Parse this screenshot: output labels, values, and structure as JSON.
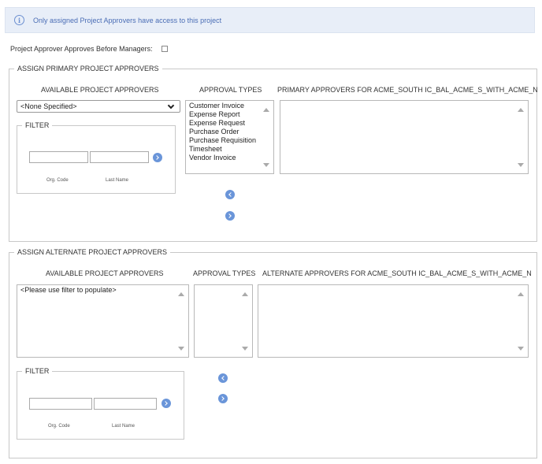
{
  "banner": {
    "text": "Only assigned Project Approvers have access to this project"
  },
  "settings": {
    "approve_before_managers_label": "Project Approver Approves Before Managers:"
  },
  "primary": {
    "legend": "ASSIGN PRIMARY PROJECT APPROVERS",
    "available_header": "AVAILABLE PROJECT APPROVERS",
    "approval_types_header": "APPROVAL TYPES",
    "approvers_header": "PRIMARY APPROVERS FOR ACME_SOUTH IC_BAL_ACME_S_WITH_ACME_N",
    "available_select_value": "<None Specified>",
    "filter": {
      "legend": "FILTER",
      "org_code_label": "Org. Code",
      "last_name_label": "Last Name"
    },
    "approval_types": [
      "Customer Invoice",
      "Expense Report",
      "Expense Request",
      "Purchase Order",
      "Purchase Requisition",
      "Timesheet",
      "Vendor Invoice"
    ]
  },
  "alternate": {
    "legend": "ASSIGN ALTERNATE PROJECT APPROVERS",
    "available_header": "AVAILABLE PROJECT APPROVERS",
    "approval_types_header": "APPROVAL TYPES",
    "approvers_header": "ALTERNATE APPROVERS FOR ACME_SOUTH IC_BAL_ACME_S_WITH_ACME_N",
    "available_placeholder_item": "<Please use filter to populate>",
    "filter": {
      "legend": "FILTER",
      "org_code_label": "Org. Code",
      "last_name_label": "Last Name"
    }
  }
}
